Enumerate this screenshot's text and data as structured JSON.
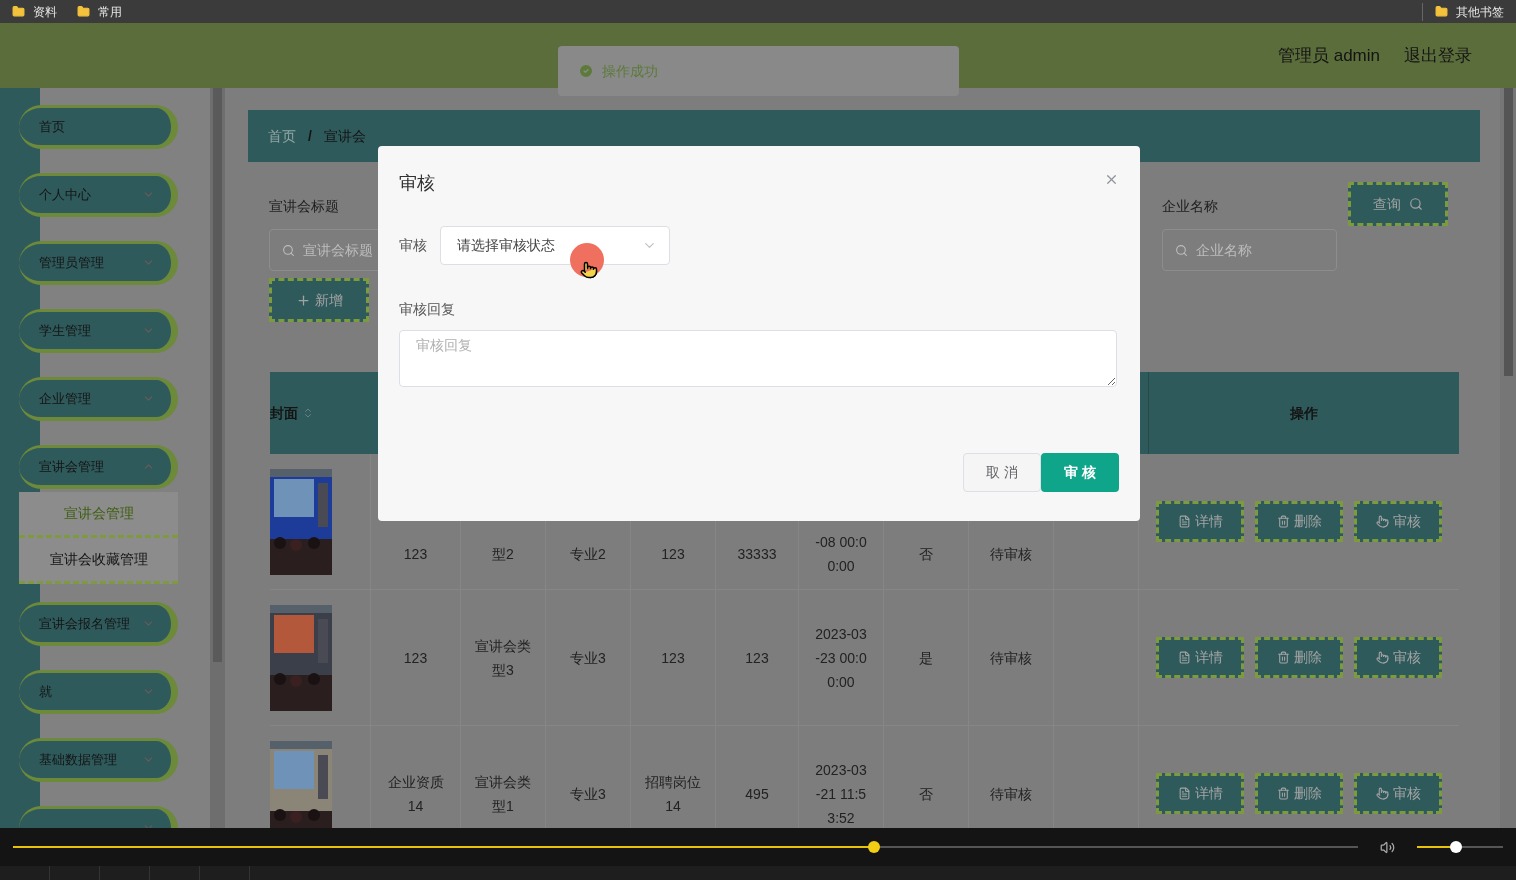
{
  "bookmarks": {
    "folders": [
      "资料",
      "常用"
    ],
    "other": "其他书签"
  },
  "header": {
    "user": "管理员 admin",
    "logout": "退出登录"
  },
  "toast": {
    "message": "操作成功"
  },
  "sidebar": {
    "items": [
      {
        "label": "首页",
        "kind": "link"
      },
      {
        "label": "个人中心",
        "kind": "submenu",
        "expanded": false
      },
      {
        "label": "管理员管理",
        "kind": "submenu",
        "expanded": false
      },
      {
        "label": "学生管理",
        "kind": "submenu",
        "expanded": false
      },
      {
        "label": "企业管理",
        "kind": "submenu",
        "expanded": false
      },
      {
        "label": "宣讲会管理",
        "kind": "submenu",
        "expanded": true,
        "children": [
          {
            "label": "宣讲会管理",
            "selected": true
          },
          {
            "label": "宣讲会收藏管理",
            "selected": false
          }
        ]
      },
      {
        "label": "宣讲会报名管理",
        "kind": "submenu",
        "expanded": false
      },
      {
        "label": "就",
        "kind": "submenu",
        "expanded": false
      },
      {
        "label": "基础数据管理",
        "kind": "submenu",
        "expanded": false
      },
      {
        "kind": "submenu",
        "expanded": false
      }
    ]
  },
  "breadcrumb": {
    "items": [
      "首页",
      "宣讲会"
    ],
    "separator": "/"
  },
  "search": {
    "fields": [
      {
        "label": "宣讲会标题",
        "placeholder": "宣讲会标题"
      },
      {
        "label": "企业名称",
        "placeholder": "企业名称"
      }
    ],
    "button": "查询"
  },
  "add_button": "新增",
  "table": {
    "columns": [
      "封面",
      "操作"
    ],
    "rows": [
      {
        "cells": [
          "123",
          "型2",
          "专业2",
          "123",
          "33333",
          "-08 00:0\n0:00",
          "否",
          "待审核",
          ""
        ],
        "actions": [
          "详情",
          "删除",
          "审核"
        ]
      },
      {
        "cells": [
          "123",
          "宣讲会类型3",
          "专业3",
          "123",
          "123",
          "2023-03\n-23 00:0\n0:00",
          "是",
          "待审核",
          ""
        ],
        "actions": [
          "详情",
          "删除",
          "审核"
        ]
      },
      {
        "cells": [
          "企业资质14",
          "宣讲会类型1",
          "专业3",
          "招聘岗位14",
          "495",
          "2023-03\n-21 11:5\n3:52",
          "否",
          "待审核",
          ""
        ],
        "actions": [
          "详情",
          "删除",
          "审核"
        ]
      }
    ]
  },
  "dialog": {
    "title": "审核",
    "status_label": "审核",
    "status_placeholder": "请选择审核状态",
    "reply_label": "审核回复",
    "reply_placeholder": "审核回复",
    "cancel": "取 消",
    "confirm": "审 核"
  },
  "player": {
    "progress": {
      "level": 0.64
    },
    "volume": {
      "level": 0.45
    }
  }
}
